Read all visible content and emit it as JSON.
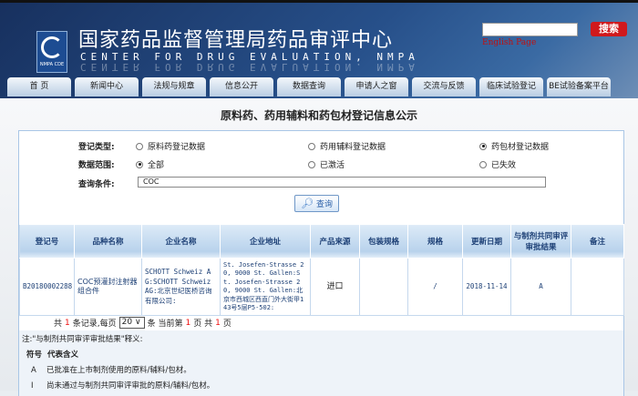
{
  "header": {
    "title_cn": "国家药品监督管理局药品审评中心",
    "title_en": "CENTER FOR DRUG EVALUATION, NMPA",
    "logo_text": "NMPA CDE",
    "search_button": "搜索",
    "search_value": "",
    "english_link": "English Page"
  },
  "nav": [
    "首 页",
    "新闻中心",
    "法规与规章",
    "信息公开",
    "数据查询",
    "申请人之窗",
    "交流与反馈",
    "临床试验登记",
    "BE试验备案平台"
  ],
  "page_title": "原料药、药用辅料和药包材登记信息公示",
  "form": {
    "type_label": "登记类型:",
    "type_options": [
      "原料药登记数据",
      "药用辅料登记数据",
      "药包材登记数据"
    ],
    "type_selected": 2,
    "range_label": "数据范围:",
    "range_options": [
      "全部",
      "已激活",
      "已失效"
    ],
    "range_selected": 0,
    "query_label": "查询条件:",
    "query_value": "COC",
    "query_button": "查询"
  },
  "table": {
    "headers": [
      "登记号",
      "品种名称",
      "企业名称",
      "企业地址",
      "产品来源",
      "包装规格",
      "规格",
      "更新日期",
      "与制剂共同审评审批结果",
      "备注"
    ],
    "rows": [
      [
        "B20180002288",
        "COC预灌封注射器组合件",
        "SCHOTT Schweiz AG:SCHOTT Schweiz AG:北京世纪医桥咨询有限公司:",
        "St. Josefen-Strasse 20, 9000 St. Gallen:St. Josefen-Strasse 20, 9000 St. Gallen:北京市西城区西直门外大街甲143号5层P5-502:",
        "进口",
        "",
        "/",
        "2018-11-14",
        "A",
        ""
      ]
    ]
  },
  "pagination": {
    "p1": "共",
    "total": "1",
    "p2": "条记录,每页",
    "page_size": "20",
    "p3": "条 当前第",
    "current": "1",
    "p4": "页 共",
    "pages": "1",
    "p5": "页"
  },
  "notes": {
    "title": "注:\"与制剂共同审评审批结果\"释义:",
    "col_symbol": "符号",
    "col_meaning": "代表含义",
    "items": [
      {
        "symbol": "A",
        "meaning": "已批准在上市制剂使用的原料/辅料/包材。"
      },
      {
        "symbol": "I",
        "meaning": "尚未通过与制剂共同审评审批的原料/辅料/包材。"
      }
    ]
  }
}
